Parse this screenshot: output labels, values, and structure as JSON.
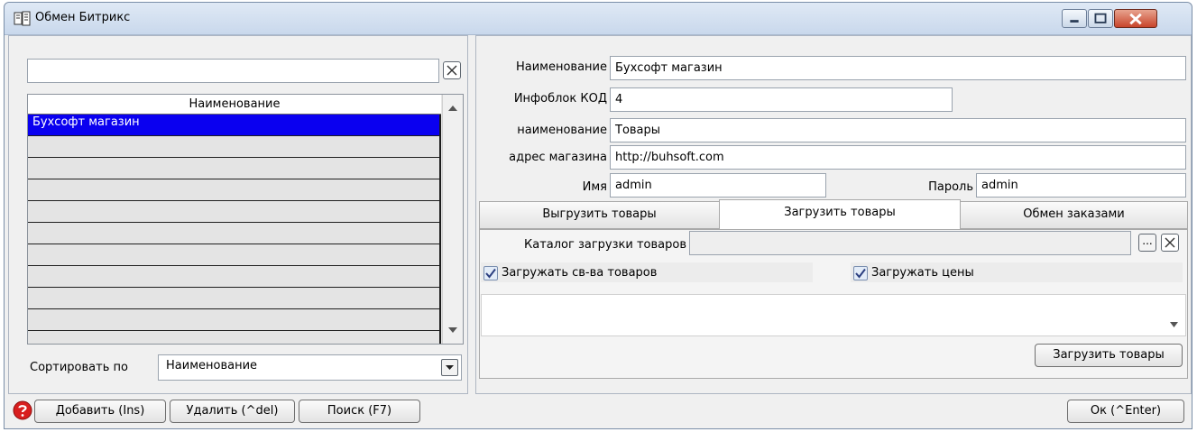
{
  "window": {
    "title": "Обмен Битрикс"
  },
  "left": {
    "search_value": "",
    "grid_header": "Наименование",
    "rows": [
      "Бухсофт магазин",
      "",
      "",
      "",
      "",
      "",
      "",
      "",
      "",
      "",
      ""
    ],
    "sort_label": "Сортировать по",
    "sort_value": "Наименование"
  },
  "form": {
    "name_label": "Наименование",
    "name_value": "Бухсофт магазин",
    "infoblock_label": "Инфоблок КОД",
    "infoblock_value": "4",
    "title_label": "наименование",
    "title_value": "Товары",
    "address_label": "адрес магазина",
    "address_value": "http://buhsoft.com",
    "user_label": "Имя",
    "user_value": "admin",
    "password_label": "Пароль",
    "password_value": "admin"
  },
  "tabs": [
    {
      "label": "Выгрузить товары",
      "active": false
    },
    {
      "label": "Загрузить товары",
      "active": true
    },
    {
      "label": "Обмен заказами",
      "active": false
    }
  ],
  "load_tab": {
    "catalog_label": "Каталог загрузки товаров",
    "catalog_value": "",
    "browse_label": "...",
    "load_props_label": "Загружать св-ва товаров",
    "load_props_checked": true,
    "load_prices_label": "Загружать цены",
    "load_prices_checked": true,
    "load_button": "Загрузить товары"
  },
  "footer": {
    "add_button": "Добавить (Ins)",
    "delete_button": "Удалить (^del)",
    "search_button": "Поиск (F7)",
    "ok_button": "Ок (^Enter)"
  },
  "colors": {
    "selection": "#0a00f0",
    "help_icon": "#d81e1e",
    "close_button": "#c8452b"
  }
}
